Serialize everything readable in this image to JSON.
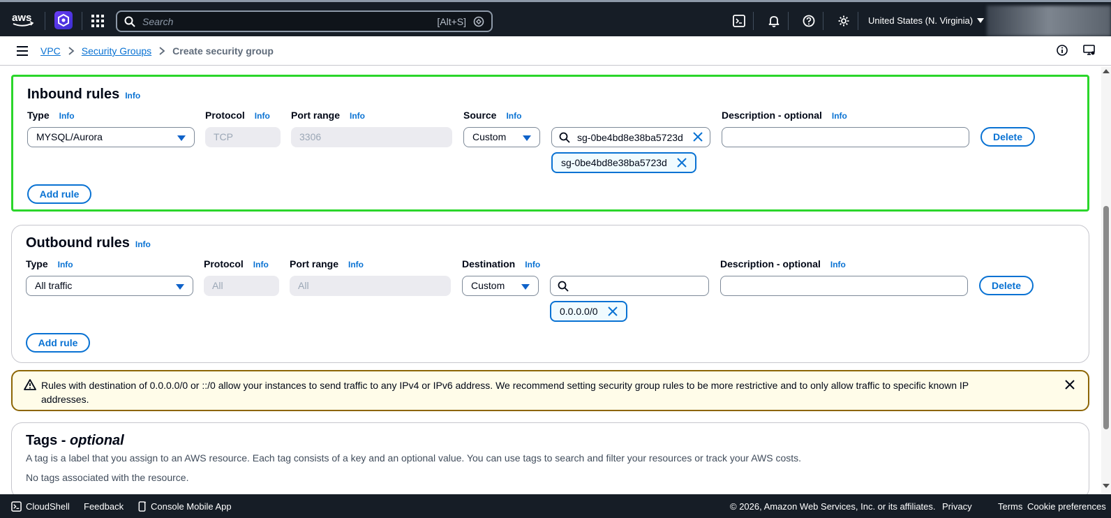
{
  "topnav": {
    "search_placeholder": "Search",
    "search_shortcut": "[Alt+S]",
    "region": "United States (N. Virginia)"
  },
  "breadcrumb": {
    "items": [
      "VPC",
      "Security Groups"
    ],
    "current": "Create security group"
  },
  "inbound": {
    "title": "Inbound rules",
    "info": "Info",
    "labels": {
      "type": "Type",
      "protocol": "Protocol",
      "port_range": "Port range",
      "source": "Source",
      "description": "Description - optional"
    },
    "rule": {
      "type": "MYSQL/Aurora",
      "protocol": "TCP",
      "port_range": "3306",
      "source": "Custom",
      "search_value": "sg-0be4bd8e38ba5723d",
      "token": "sg-0be4bd8e38ba5723d",
      "description": ""
    },
    "delete_label": "Delete",
    "add_rule_label": "Add rule"
  },
  "outbound": {
    "title": "Outbound rules",
    "info": "Info",
    "labels": {
      "type": "Type",
      "protocol": "Protocol",
      "port_range": "Port range",
      "destination": "Destination",
      "description": "Description - optional"
    },
    "rule": {
      "type": "All traffic",
      "protocol": "All",
      "port_range": "All",
      "destination": "Custom",
      "search_value": "",
      "token": "0.0.0.0/0",
      "description": ""
    },
    "delete_label": "Delete",
    "add_rule_label": "Add rule"
  },
  "alert": {
    "message": "Rules with destination of 0.0.0.0/0 or ::/0 allow your instances to send traffic to any IPv4 or IPv6 address. We recommend setting security group rules to be more restrictive and to only allow traffic to specific known IP addresses."
  },
  "tags": {
    "title_main": "Tags - ",
    "title_optional": "optional",
    "description": "A tag is a label that you assign to an AWS resource. Each tag consists of a key and an optional value. You can use tags to search and filter your resources or track your AWS costs.",
    "empty": "No tags associated with the resource."
  },
  "footer": {
    "cloudshell": "CloudShell",
    "feedback": "Feedback",
    "mobile_app": "Console Mobile App",
    "copyright": "© 2026, Amazon Web Services, Inc. or its affiliates.",
    "privacy": "Privacy",
    "terms": "Terms",
    "cookie": "Cookie preferences"
  },
  "colors": {
    "nav_bg": "#161d26",
    "link": "#0972d3",
    "highlight": "#2bd62b",
    "warning_border": "#8d6605",
    "warning_bg": "#fffce9"
  }
}
